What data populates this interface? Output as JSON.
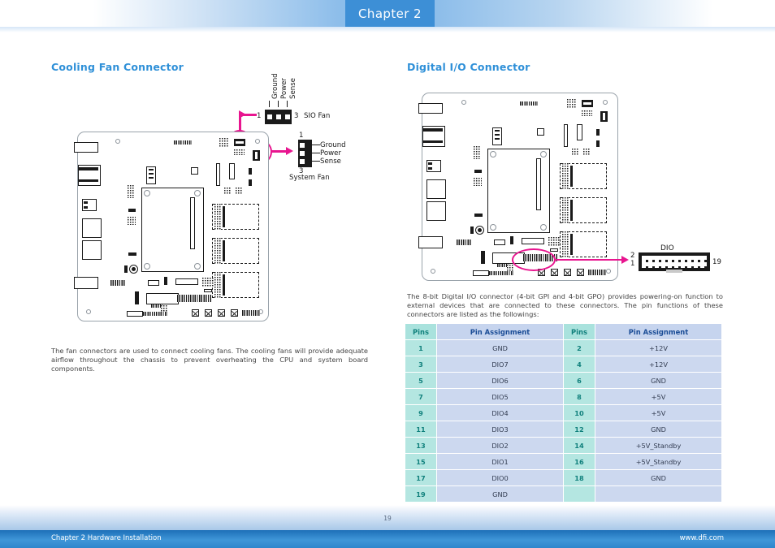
{
  "header": {
    "chapter_tab": "Chapter 2"
  },
  "left_section": {
    "title": "Cooling Fan Connector",
    "description": "The fan connectors are used to connect cooling fans. The cooling fans will provide adequate airflow throughout the chassis to prevent overheating the CPU and system board components.",
    "sio_fan": {
      "name": "SIO Fan",
      "pin_first": "1",
      "pin_last": "3",
      "signals": [
        "Ground",
        "Power",
        "Sense"
      ]
    },
    "system_fan": {
      "name": "System Fan",
      "pin_first": "1",
      "pin_last": "3",
      "signals": [
        "Ground",
        "Power",
        "Sense"
      ]
    }
  },
  "right_section": {
    "title": "Digital I/O Connector",
    "description": "The 8-bit Digital I/O connector (4-bit GPI and 4-bit GPO) provides powering-on function to external devices that are connected to these connectors. The pin functions of these connectors are listed as the followings:",
    "dio_connector": {
      "name": "DIO",
      "pin_top_left": "2",
      "pin_bottom_left": "1",
      "pin_right": "19"
    },
    "table": {
      "headers": [
        "Pins",
        "Pin Assignment",
        "Pins",
        "Pin Assignment"
      ],
      "rows": [
        [
          "1",
          "GND",
          "2",
          "+12V"
        ],
        [
          "3",
          "DIO7",
          "4",
          "+12V"
        ],
        [
          "5",
          "DIO6",
          "6",
          "GND"
        ],
        [
          "7",
          "DIO5",
          "8",
          "+5V"
        ],
        [
          "9",
          "DIO4",
          "10",
          "+5V"
        ],
        [
          "11",
          "DIO3",
          "12",
          "GND"
        ],
        [
          "13",
          "DIO2",
          "14",
          "+5V_Standby"
        ],
        [
          "15",
          "DIO1",
          "16",
          "+5V_Standby"
        ],
        [
          "17",
          "DIO0",
          "18",
          "GND"
        ],
        [
          "19",
          "GND",
          "",
          ""
        ]
      ]
    }
  },
  "footer": {
    "page_number": "19",
    "left_text": "Chapter 2 Hardware Installation",
    "right_text": "www.dfi.com"
  },
  "colors": {
    "accent_blue": "#2f90d8",
    "tab_blue": "#3d8fd6",
    "highlight_magenta": "#e8158f",
    "table_pin_bg": "#b4e6e1",
    "table_pin_text": "#10807c",
    "table_assign_bg": "#ccd8ef",
    "table_assign_header_text": "#1a4c96"
  }
}
